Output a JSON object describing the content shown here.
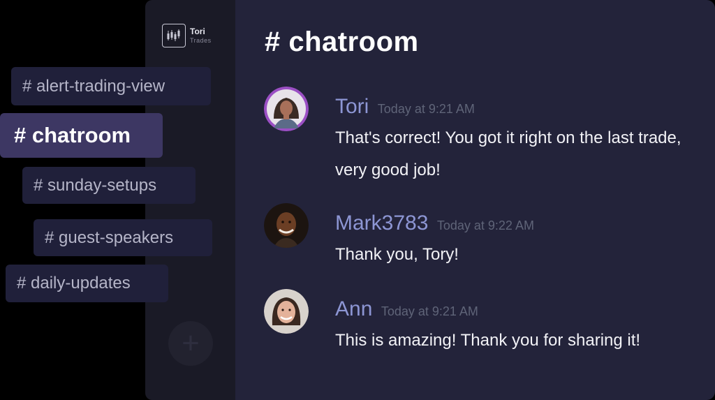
{
  "logo": {
    "name": "Tori",
    "subtitle": "Trades"
  },
  "channel": {
    "title": "# chatroom"
  },
  "channels": [
    {
      "label": "# alert-trading-view",
      "active": false
    },
    {
      "label": "# chatroom",
      "active": true
    },
    {
      "label": "# sunday-setups",
      "active": false
    },
    {
      "label": "# guest-speakers",
      "active": false
    },
    {
      "label": "# daily-updates",
      "active": false
    }
  ],
  "add_button": {
    "icon": "plus-icon",
    "glyph": "+"
  },
  "messages": [
    {
      "author": "Tori",
      "time": "Today at 9:21 AM",
      "text": "That's correct! You got it right on the last trade, very good job!",
      "avatar": "tori-avatar"
    },
    {
      "author": "Mark3783",
      "time": "Today at 9:22 AM",
      "text": "Thank you, Tory!",
      "avatar": "mark-avatar"
    },
    {
      "author": "Ann",
      "time": "Today at 9:21 AM",
      "text": "This is amazing! Thank you for sharing it!",
      "avatar": "ann-avatar"
    }
  ],
  "colors": {
    "background": "#000000",
    "sidebar": "#1a1a26",
    "main": "#23233a",
    "pill": "#20203a",
    "pill_active": "#3d3763",
    "author": "#8d96d4",
    "timestamp": "#5f6478",
    "text": "#f2f2f6"
  }
}
